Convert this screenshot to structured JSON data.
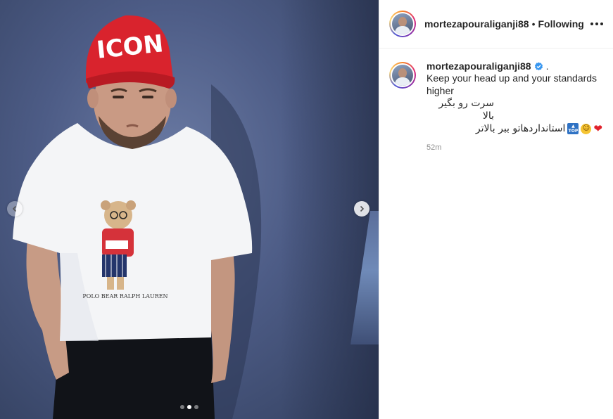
{
  "post": {
    "username": "mortezapouraliganji88",
    "follow_label": "Following",
    "separator": "•",
    "more_label": "More options"
  },
  "caption": {
    "username": "mortezapouraliganji88",
    "trailing": ".",
    "line1": "Keep your head up and your standards",
    "line2": "higher",
    "line3": "سرت رو بگیر بالا",
    "line4": "استانداردهاتو ببر بالاتر",
    "emoji_top": "TOP",
    "timestamp": "52m"
  },
  "media": {
    "cap_text": "ICON",
    "shirt_text": "POLO BEAR  RALPH LAUREN",
    "carousel": {
      "count": 3,
      "active": 2
    }
  },
  "icons": [
    "chevron-left-icon",
    "chevron-right-icon",
    "verified-badge-icon",
    "more-dots-icon"
  ]
}
